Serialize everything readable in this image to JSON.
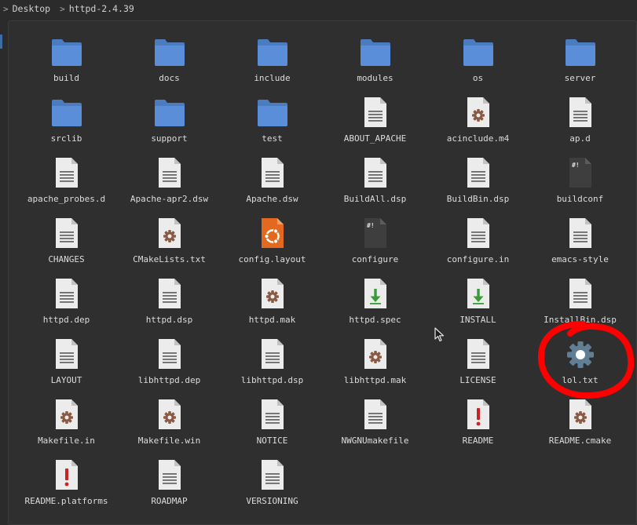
{
  "breadcrumb": [
    "Desktop",
    "httpd-2.4.39"
  ],
  "colors": {
    "folder": "#5b8ed8",
    "annotation": "#ff0000",
    "background": "#2b2b2b"
  },
  "items": [
    {
      "name": "build",
      "icon": "folder-icon"
    },
    {
      "name": "docs",
      "icon": "folder-icon"
    },
    {
      "name": "include",
      "icon": "folder-icon"
    },
    {
      "name": "modules",
      "icon": "folder-icon"
    },
    {
      "name": "os",
      "icon": "folder-icon"
    },
    {
      "name": "server",
      "icon": "folder-icon"
    },
    {
      "name": "srclib",
      "icon": "folder-icon"
    },
    {
      "name": "support",
      "icon": "folder-icon"
    },
    {
      "name": "test",
      "icon": "folder-icon"
    },
    {
      "name": "ABOUT_APACHE",
      "icon": "text-file-icon"
    },
    {
      "name": "acinclude.m4",
      "icon": "gear-file-icon"
    },
    {
      "name": "ap.d",
      "icon": "text-file-icon"
    },
    {
      "name": "apache_probes.d",
      "icon": "text-file-icon"
    },
    {
      "name": "Apache-apr2.dsw",
      "icon": "text-file-icon"
    },
    {
      "name": "Apache.dsw",
      "icon": "text-file-icon"
    },
    {
      "name": "BuildAll.dsp",
      "icon": "text-file-icon"
    },
    {
      "name": "BuildBin.dsp",
      "icon": "text-file-icon"
    },
    {
      "name": "buildconf",
      "icon": "script-file-icon"
    },
    {
      "name": "CHANGES",
      "icon": "text-file-icon"
    },
    {
      "name": "CMakeLists.txt",
      "icon": "gear-file-icon"
    },
    {
      "name": "config.layout",
      "icon": "ubuntu-file-icon"
    },
    {
      "name": "configure",
      "icon": "script-file-icon"
    },
    {
      "name": "configure.in",
      "icon": "text-file-icon"
    },
    {
      "name": "emacs-style",
      "icon": "text-file-icon"
    },
    {
      "name": "httpd.dep",
      "icon": "text-file-icon"
    },
    {
      "name": "httpd.dsp",
      "icon": "text-file-icon"
    },
    {
      "name": "httpd.mak",
      "icon": "gear-file-icon"
    },
    {
      "name": "httpd.spec",
      "icon": "install-file-icon"
    },
    {
      "name": "INSTALL",
      "icon": "install-file-icon"
    },
    {
      "name": "InstallBin.dsp",
      "icon": "text-file-icon"
    },
    {
      "name": "LAYOUT",
      "icon": "text-file-icon"
    },
    {
      "name": "libhttpd.dep",
      "icon": "text-file-icon"
    },
    {
      "name": "libhttpd.dsp",
      "icon": "text-file-icon"
    },
    {
      "name": "libhttpd.mak",
      "icon": "gear-file-icon"
    },
    {
      "name": "LICENSE",
      "icon": "text-file-icon"
    },
    {
      "name": "lol.txt",
      "icon": "gear-big-icon"
    },
    {
      "name": "Makefile.in",
      "icon": "gear-file-icon"
    },
    {
      "name": "Makefile.win",
      "icon": "gear-file-icon"
    },
    {
      "name": "NOTICE",
      "icon": "text-file-icon"
    },
    {
      "name": "NWGNUmakefile",
      "icon": "text-file-icon"
    },
    {
      "name": "README",
      "icon": "alert-file-icon"
    },
    {
      "name": "README.cmake",
      "icon": "gear-file-icon"
    },
    {
      "name": "README.platforms",
      "icon": "alert-file-icon"
    },
    {
      "name": "ROADMAP",
      "icon": "text-file-icon"
    },
    {
      "name": "VERSIONING",
      "icon": "text-file-icon"
    }
  ]
}
